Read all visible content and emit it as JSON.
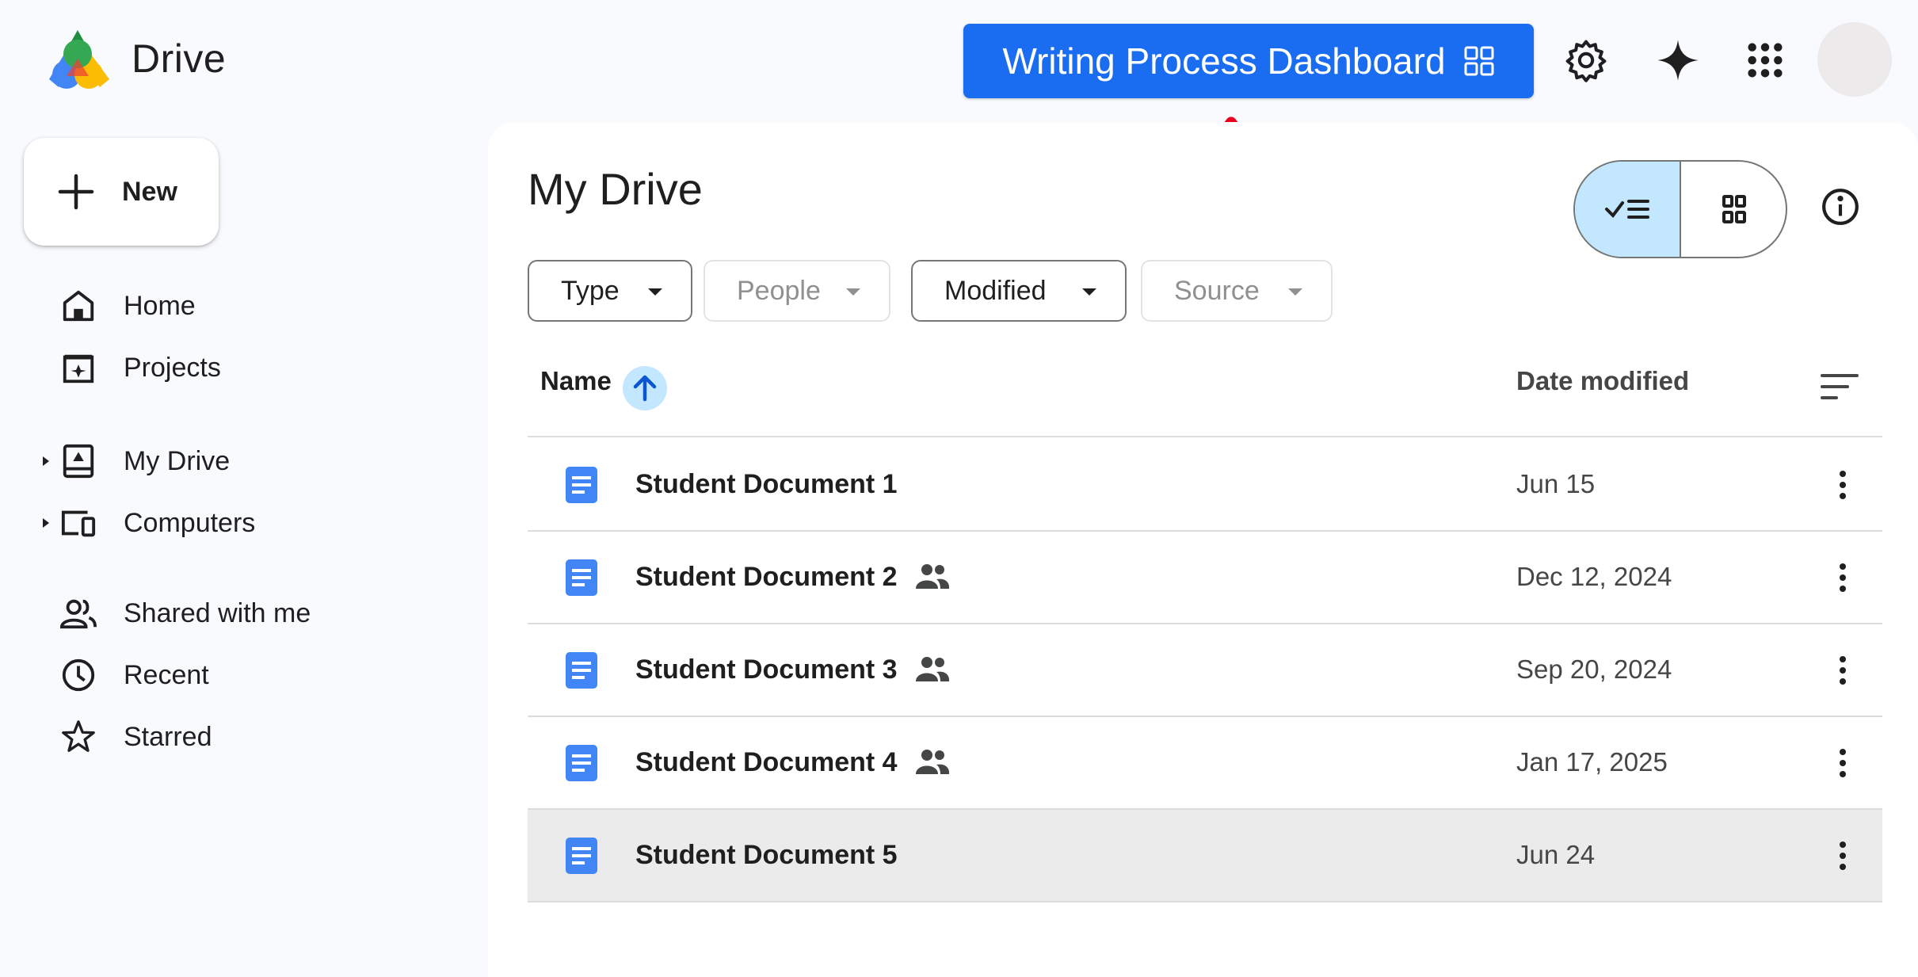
{
  "app": {
    "name": "Drive"
  },
  "header": {
    "dashboard_button": "Writing Process Dashboard",
    "icons": [
      "settings-icon",
      "gemini-icon",
      "apps-icon"
    ]
  },
  "sidebar": {
    "new_label": "New",
    "items": [
      {
        "label": "Home",
        "icon": "home-icon"
      },
      {
        "label": "Projects",
        "icon": "projects-icon"
      },
      {
        "label": "My Drive",
        "icon": "my-drive-icon",
        "expandable": true
      },
      {
        "label": "Computers",
        "icon": "computers-icon",
        "expandable": true
      },
      {
        "label": "Shared with me",
        "icon": "shared-icon"
      },
      {
        "label": "Recent",
        "icon": "clock-icon"
      },
      {
        "label": "Starred",
        "icon": "star-icon"
      }
    ]
  },
  "main": {
    "title": "My Drive",
    "view": "list",
    "filters": [
      {
        "label": "Type",
        "enabled": true
      },
      {
        "label": "People",
        "enabled": false
      },
      {
        "label": "Modified",
        "enabled": true
      },
      {
        "label": "Source",
        "enabled": false
      }
    ],
    "columns": {
      "name": "Name",
      "date": "Date modified",
      "sort": "name-ascending"
    },
    "files": [
      {
        "name": "Student Document 1",
        "shared": false,
        "date": "Jun 15"
      },
      {
        "name": "Student Document 2",
        "shared": true,
        "date": "Dec 12, 2024"
      },
      {
        "name": "Student Document 3",
        "shared": true,
        "date": "Sep 20, 2024"
      },
      {
        "name": "Student Document 4",
        "shared": true,
        "date": "Jan 17, 2025"
      },
      {
        "name": "Student Document 5",
        "shared": false,
        "date": "Jun 24",
        "selected": true
      }
    ]
  },
  "colors": {
    "accent": "#1a6cf0",
    "selected_toggle": "#c2e7ff",
    "annotation": "#e8001c",
    "doc_icon": "#4285f4"
  }
}
